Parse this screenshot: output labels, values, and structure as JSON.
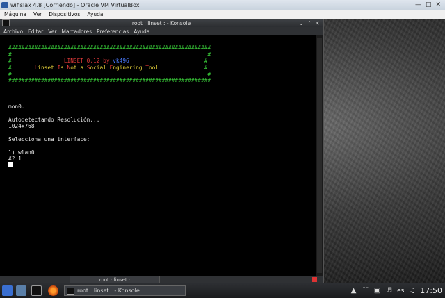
{
  "vbox": {
    "title": "wifislax 4.8 [Corriendo] - Oracle VM VirtualBox",
    "menu": [
      "Máquina",
      "Ver",
      "Dispositivos",
      "Ayuda"
    ]
  },
  "konsole": {
    "title": "root : linset : - Konsole",
    "menu": [
      "Archivo",
      "Editar",
      "Ver",
      "Marcadores",
      "Preferencias",
      "Ayuda"
    ],
    "tab_label": "root : linset :"
  },
  "terminal": {
    "banner_border": "##############################################################",
    "banner_title_prefix": "LINSET 0.12 by",
    "banner_author": "vk496",
    "banner_subtitle": "Linset Is Not a Social Enginering Tool",
    "line_mon": "mon0.",
    "line_detect": "Autodetectando Resolución...",
    "line_resolution": "1024x768",
    "line_select": "Selecciona una interface:",
    "option_1_num": "1)",
    "option_1_name": "wlan0",
    "prompt": "#?",
    "input_value": "1"
  },
  "taskbar": {
    "task_label": "root : linset : - Konsole",
    "language": "es",
    "clock": "17:50"
  },
  "colors": {
    "banner_green": "#3ad13a",
    "banner_red": "#e23a3a",
    "banner_blue": "#4a7bff",
    "banner_yellow": "#e6d23a"
  }
}
